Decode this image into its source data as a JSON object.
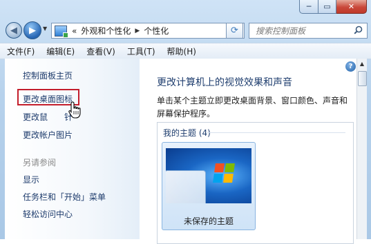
{
  "titlebar": {
    "min": "─",
    "max": "▭",
    "close": "✕"
  },
  "nav": {
    "back": "◀",
    "forward": "▶",
    "drop": "▼"
  },
  "address": {
    "prefix": "«",
    "segments": [
      "外观和个性化",
      "个性化"
    ],
    "separator": "▶",
    "dropdown": "▼"
  },
  "refresh": "⟳",
  "search": {
    "placeholder": "搜索控制面板",
    "icon": "🔍"
  },
  "menu": [
    "文件(F)",
    "编辑(E)",
    "查看(V)",
    "工具(T)",
    "帮助(H)"
  ],
  "left_nav": {
    "home": "控制面板主页",
    "change_desktop_icons": "更改桌面图标",
    "change_mouse_pointer": "更改鼠标指针",
    "change_mouse_pointer_visible": "更改鼠",
    "change_mouse_pointer_tail": "针",
    "change_account_picture": "更改帐户图片",
    "see_also": "另请参阅",
    "display": "显示",
    "taskbar": "任务栏和「开始」菜单",
    "ease_of_access": "轻松访问中心"
  },
  "main": {
    "title": "更改计算机上的视觉效果和声音",
    "description": "单击某个主题立即更改桌面背景、窗口颜色、声音和屏幕保护程序。",
    "help": "?",
    "my_themes": "我的主题 (4)",
    "theme_name": "未保存的主题"
  },
  "colors": {
    "link": "#1c3a6b",
    "highlight": "#c31d2b",
    "logo": [
      "#f25022",
      "#7fba00",
      "#00a4ef",
      "#ffb900"
    ]
  }
}
